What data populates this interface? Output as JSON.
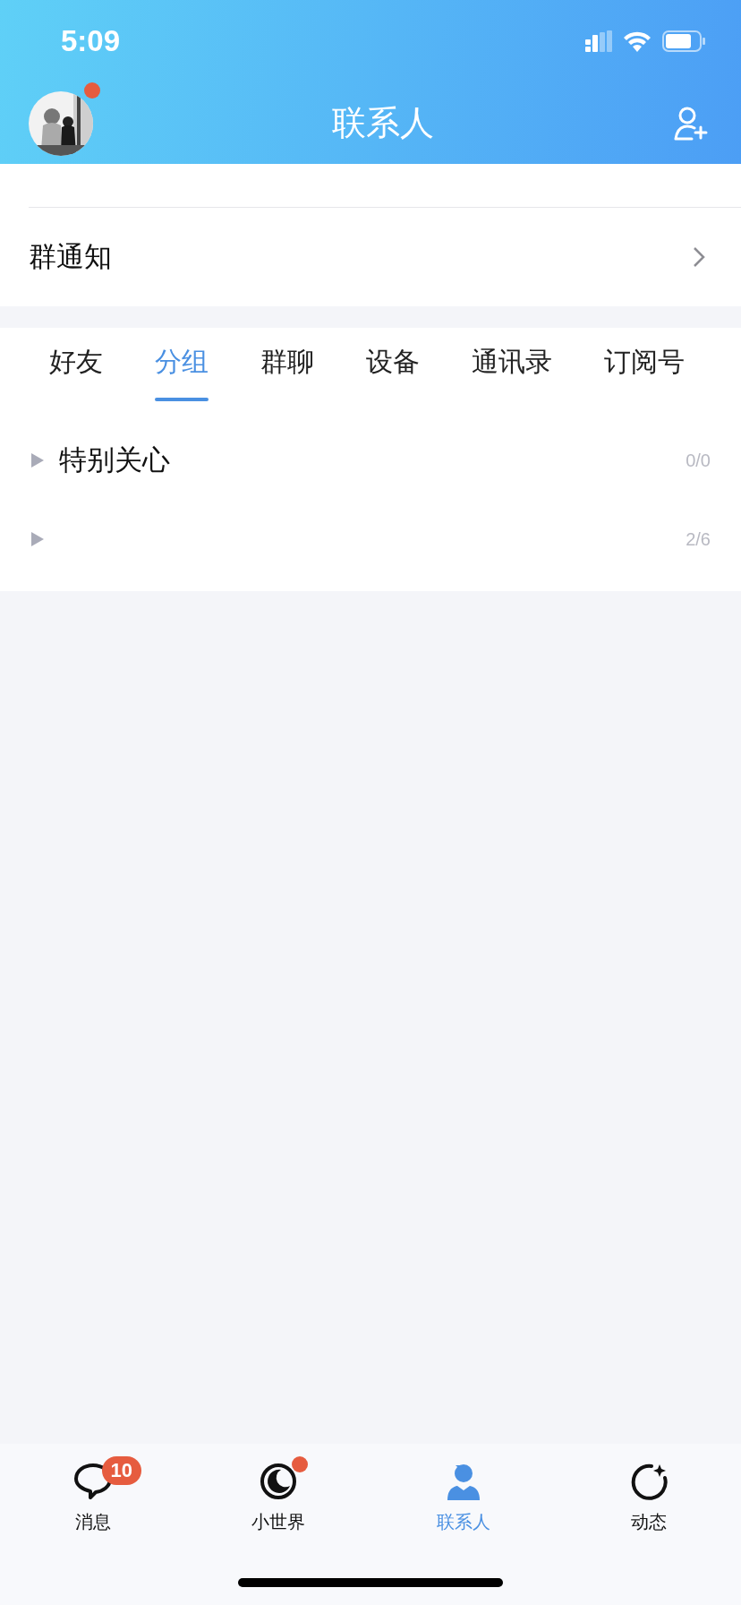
{
  "status_bar": {
    "time": "5:09"
  },
  "header": {
    "title": "联系人",
    "avatar_unread": true
  },
  "rows": [
    {
      "label": "群通知"
    }
  ],
  "tabs": [
    {
      "label": "好友",
      "selected": false
    },
    {
      "label": "分组",
      "selected": true
    },
    {
      "label": "群聊",
      "selected": false
    },
    {
      "label": "设备",
      "selected": false
    },
    {
      "label": "通讯录",
      "selected": false
    },
    {
      "label": "订阅号",
      "selected": false
    }
  ],
  "groups": [
    {
      "name": "特别关心",
      "count": "0/0",
      "expanded": false
    },
    {
      "count": "2/6",
      "expanded": false
    }
  ],
  "tab_bar": [
    {
      "kind": "chat",
      "label": "消息",
      "selected": false,
      "badge": "10"
    },
    {
      "kind": "planet",
      "label": "小世界",
      "selected": false,
      "dot": true
    },
    {
      "kind": "person",
      "label": "联系人",
      "selected": true
    },
    {
      "kind": "refresh",
      "label": "动态",
      "selected": false
    }
  ]
}
